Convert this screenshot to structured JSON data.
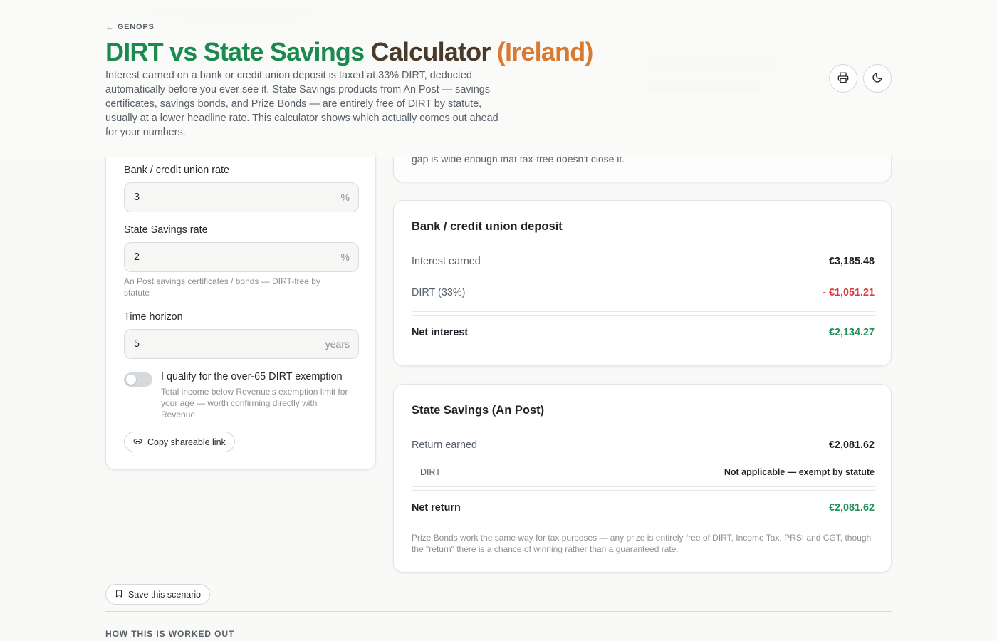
{
  "header": {
    "back_label": "GENOPS",
    "title_part1": "DIRT vs State Savings Calculator",
    "title_part2": "(Ireland)",
    "intro": "Interest earned on a bank or credit union deposit is taxed at 33% DIRT, deducted automatically before you ever see it. State Savings products from An Post — savings certificates, savings bonds, and Prize Bonds — are entirely free of DIRT by statute, usually at a lower headline rate. This calculator shows which actually comes out ahead for your numbers."
  },
  "inputs": {
    "bank_rate": {
      "label": "Bank / credit union rate",
      "value": "3",
      "unit": "%"
    },
    "state_rate": {
      "label": "State Savings rate",
      "value": "2",
      "unit": "%",
      "help": "An Post savings certificates / bonds — DIRT-free by statute"
    },
    "horizon": {
      "label": "Time horizon",
      "value": "5",
      "unit": "years"
    },
    "over65": {
      "label": "I qualify for the over-65 DIRT exemption",
      "checked": false,
      "help": "Total income below Revenue's exemption limit for your age — worth confirming directly with Revenue"
    },
    "copy_link_label": "Copy shareable link"
  },
  "verdict": {
    "text": "gap is wide enough that tax-free doesn't close it."
  },
  "bank": {
    "title": "Bank / credit union deposit",
    "interest_label": "Interest earned",
    "interest_value": "€3,185.48",
    "dirt_label": "DIRT (33%)",
    "dirt_value": "- €1,051.21",
    "net_label": "Net interest",
    "net_value": "€2,134.27"
  },
  "state": {
    "title": "State Savings (An Post)",
    "return_label": "Return earned",
    "return_value": "€2,081.62",
    "dirt_label": "DIRT",
    "dirt_value": "Not applicable — exempt by statute",
    "net_label": "Net return",
    "net_value": "€2,081.62",
    "note": "Prize Bonds work the same way for tax purposes — any prize is entirely free of DIRT, Income Tax, PRSI and CGT, though the \"return\" there is a chance of winning rather than a guaranteed rate."
  },
  "actions": {
    "save_label": "Save this scenario"
  },
  "section": {
    "heading": "HOW THIS IS WORKED OUT"
  },
  "icons": {
    "back": "arrow-left-icon",
    "print": "printer-icon",
    "theme": "moon-icon",
    "link": "link-icon",
    "bookmark": "bookmark-icon"
  },
  "colors": {
    "title_green": "#1a8a4e",
    "title_orange": "#d87a33",
    "negative": "#d93a3a",
    "positive": "#1f8f5a"
  }
}
